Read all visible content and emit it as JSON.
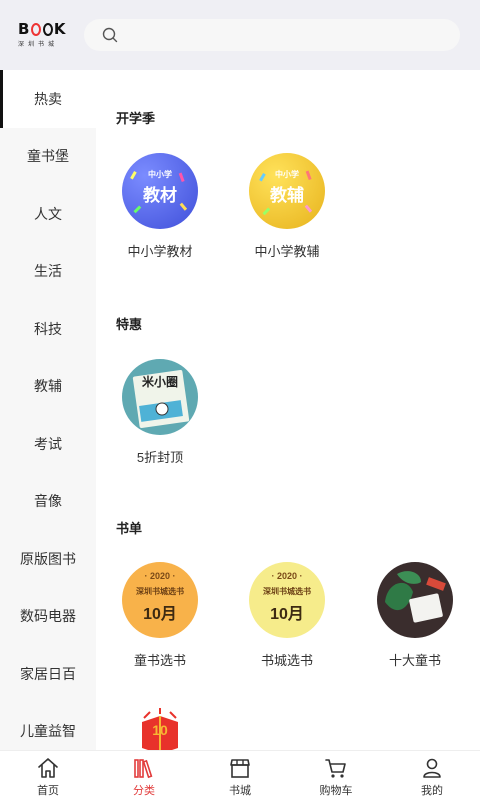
{
  "logo": {
    "text": "BOOK",
    "subtitle": "深圳书城"
  },
  "search": {
    "placeholder": ""
  },
  "categories": [
    {
      "label": "热卖",
      "active": true
    },
    {
      "label": "童书堡"
    },
    {
      "label": "人文"
    },
    {
      "label": "生活"
    },
    {
      "label": "科技"
    },
    {
      "label": "教辅"
    },
    {
      "label": "考试"
    },
    {
      "label": "音像"
    },
    {
      "label": "原版图书"
    },
    {
      "label": "数码电器"
    },
    {
      "label": "家居日百"
    },
    {
      "label": "儿童益智"
    }
  ],
  "sections": [
    {
      "title": "开学季",
      "items": [
        {
          "label": "中小学教材",
          "art_small": "中小学",
          "art_big": "教材"
        },
        {
          "label": "中小学教辅",
          "art_small": "中小学",
          "art_big": "教辅"
        }
      ]
    },
    {
      "title": "特惠",
      "items": [
        {
          "label": "5折封顶",
          "art_text": "米小圈"
        }
      ]
    },
    {
      "title": "书单",
      "items": [
        {
          "label": "童书选书",
          "art_year": "· 2020 ·",
          "art_city": "深圳书城选书",
          "art_month": "10月"
        },
        {
          "label": "书城选书",
          "art_year": "· 2020 ·",
          "art_city": "深圳书城选书",
          "art_month": "10月"
        },
        {
          "label": "十大童书"
        }
      ]
    }
  ],
  "partial_item": {
    "art_text": "10"
  },
  "tabs": [
    {
      "label": "首页",
      "icon": "home-icon"
    },
    {
      "label": "分类",
      "icon": "category-books-icon",
      "active": true
    },
    {
      "label": "书城",
      "icon": "store-icon"
    },
    {
      "label": "购物车",
      "icon": "cart-icon"
    },
    {
      "label": "我的",
      "icon": "user-icon"
    }
  ],
  "colors": {
    "accent": "#e23c3c",
    "active_bar": "#111111"
  }
}
